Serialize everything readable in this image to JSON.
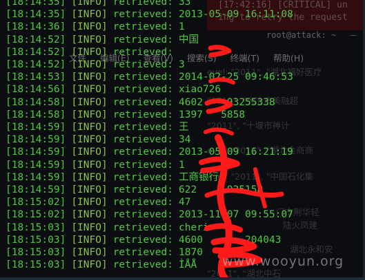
{
  "background_window": {
    "error_lines": [
      "[17:42:16] [CRITICAL] un",
      "ing to retry the request"
    ],
    "title": "root@attack: ~",
    "menu": [
      "文件",
      "编辑(E)",
      "查看(V)",
      "搜索(S)",
      "终端(T)",
      "帮助(H)"
    ],
    "ghost_lines": [
      "evel: \"2011\", \"湖北福好医疗",
      "\"2011\", \"大冶市美融超",
      "\"2011\", \"十堰市神计",
      "evel: \"2011\", \"湖北金商商",
      "evel: \"2011\", \"中国石化集",
      "门市荆华轻",
      "陆火凤建",
      "湖北永和安",
      "\"2011\", \"湖北中石"
    ]
  },
  "log_lines": [
    {
      "time": "[18:14:35]",
      "level": "[INFO]",
      "msg": "retrieved:",
      "value": "33"
    },
    {
      "time": "[18:14:35]",
      "level": "[INFO]",
      "msg": "retrieved:",
      "value": "2013-05-09 16:11:08"
    },
    {
      "time": "[18:14:36]",
      "level": "[INFO]",
      "msg": "retrieved:",
      "value": "1"
    },
    {
      "time": "[18:14:52]",
      "level": "[INFO]",
      "msg": "retrieved:",
      "value": "中国"
    },
    {
      "time": "[18:14:52]",
      "level": "[INFO]",
      "msg": "retrieved:",
      "value": ""
    },
    {
      "time": "[18:14:52]",
      "level": "[INFO]",
      "msg": "retrieved:",
      "value": "3"
    },
    {
      "time": "[18:14:53]",
      "level": "[INFO]",
      "msg": "retrieved:",
      "value": "2014-02-25 09:46:53"
    },
    {
      "time": "[18:14:56]",
      "level": "[INFO]",
      "msg": "retrieved:",
      "value": "xiao726"
    },
    {
      "time": "[18:14:58]",
      "level": "[INFO]",
      "msg": "retrieved:",
      "value": "4602    93255338"
    },
    {
      "time": "[18:14:58]",
      "level": "[INFO]",
      "msg": "retrieved:",
      "value": "1397   5858"
    },
    {
      "time": "[18:14:59]",
      "level": "[INFO]",
      "msg": "retrieved:",
      "value": "王"
    },
    {
      "time": "[18:14:59]",
      "level": "[INFO]",
      "msg": "retrieved:",
      "value": "34"
    },
    {
      "time": "[18:14:59]",
      "level": "[INFO]",
      "msg": "retrieved:",
      "value": "2013-05-09 16:21:19"
    },
    {
      "time": "[18:14:59]",
      "level": "[INFO]",
      "msg": "retrieved:",
      "value": "1"
    },
    {
      "time": "[18:14:59]",
      "level": "[INFO]",
      "msg": "retrieved:",
      "value": "工商银行"
    },
    {
      "time": "[18:14:59]",
      "level": "[INFO]",
      "msg": "retrieved:",
      "value": "622     925158"
    },
    {
      "time": "[18:15:02]",
      "level": "[INFO]",
      "msg": "retrieved:",
      "value": "47"
    },
    {
      "time": "[18:15:02]",
      "level": "[INFO]",
      "msg": "retrieved:",
      "value": "2013-11-07 09:55:07"
    },
    {
      "time": "[18:15:03]",
      "level": "[INFO]",
      "msg": "retrieved:",
      "value": "cheri"
    },
    {
      "time": "[18:15:03]",
      "level": "[INFO]",
      "msg": "retrieved:",
      "value": "4600    8  204043"
    },
    {
      "time": "[18:15:03]",
      "level": "[INFO]",
      "msg": "retrieved:",
      "value": "1870"
    },
    {
      "time": "[18:15:03]",
      "level": "[INFO]",
      "msg": "retrieved:",
      "value": "ÌÅÅ"
    }
  ],
  "watermark": {
    "text": "www.wooyun.org"
  },
  "colors": {
    "log_green": "#50c840",
    "redaction_red": "#ff1a1a",
    "background": "#0b0d10"
  }
}
